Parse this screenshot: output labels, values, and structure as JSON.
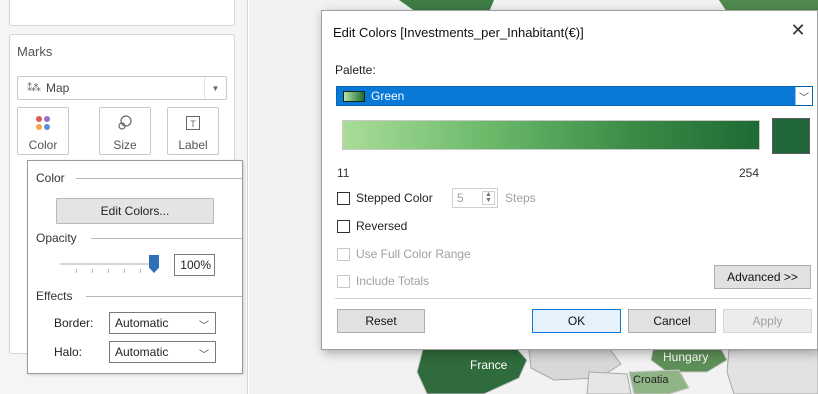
{
  "marks_panel": {
    "title": "Marks",
    "mark_type": "Map",
    "mark_buttons": [
      "Color",
      "Size",
      "Label"
    ],
    "color_section": {
      "heading": "Color",
      "edit_colors_label": "Edit Colors...",
      "opacity_heading": "Opacity",
      "opacity_value": "100%",
      "opacity_fraction": 1.0,
      "effects_heading": "Effects",
      "border_label": "Border:",
      "border_value": "Automatic",
      "halo_label": "Halo:",
      "halo_value": "Automatic"
    }
  },
  "dialog": {
    "title": "Edit Colors [Investments_per_Inhabitant(€)]",
    "close_glyph": "✕",
    "palette_label": "Palette:",
    "palette_value": "Green",
    "range_min": "11",
    "range_max": "254",
    "stepped_color_label": "Stepped Color",
    "stepped_color_checked": false,
    "steps_value": "5",
    "steps_label": "Steps",
    "reversed_label": "Reversed",
    "reversed_checked": false,
    "use_full_color_range_label": "Use Full Color Range",
    "include_totals_label": "Include Totals",
    "advanced_label": "Advanced >>",
    "reset_label": "Reset",
    "ok_label": "OK",
    "cancel_label": "Cancel",
    "apply_label": "Apply",
    "colors": {
      "gradient_start": "#a9dd98",
      "gradient_end": "#1e6a34",
      "end_swatch": "#21673b",
      "selection_blue": "#0a78d7"
    }
  },
  "map": {
    "labels": [
      "France",
      "Hungary",
      "Croatia"
    ],
    "colors": {
      "dark_green": "#2f6b3c",
      "mid_green": "#5e8f58",
      "light_green": "#8fb586",
      "gray": "#9a9a9a"
    }
  }
}
